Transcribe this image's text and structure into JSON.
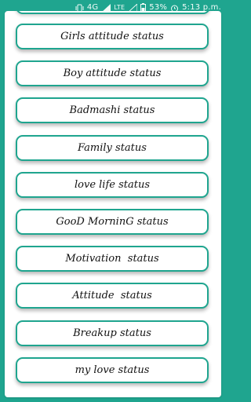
{
  "status_bar": {
    "network_label": "4G",
    "lte_label": "LTE",
    "battery_percent": "53%",
    "time": "5:13 p.m."
  },
  "buttons": [
    {
      "label": "Girls attitude status"
    },
    {
      "label": "Boy attitude status"
    },
    {
      "label": "Badmashi status"
    },
    {
      "label": "Family status"
    },
    {
      "label": "love life status"
    },
    {
      "label": "GooD MorninG status"
    },
    {
      "label": "Motivation  status"
    },
    {
      "label": "Attitude  status"
    },
    {
      "label": "Breakup status"
    },
    {
      "label": "my love status"
    }
  ],
  "colors": {
    "accent": "#1fa58f",
    "panel": "#ffffff",
    "text": "#111111"
  }
}
